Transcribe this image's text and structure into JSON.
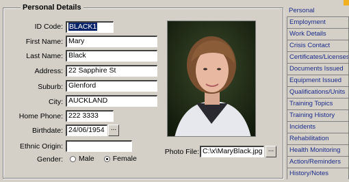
{
  "section_title": "Personal Details",
  "fields": {
    "id_code": {
      "label": "ID Code:",
      "value": "BLACK1"
    },
    "first_name": {
      "label": "First Name:",
      "value": "Mary"
    },
    "last_name": {
      "label": "Last Name:",
      "value": "Black"
    },
    "address": {
      "label": "Address:",
      "value": "22 Sapphire St"
    },
    "suburb": {
      "label": "Suburb:",
      "value": "Glenford"
    },
    "city": {
      "label": "City:",
      "value": "AUCKLAND"
    },
    "home_phone": {
      "label": "Home Phone:",
      "value": "222 3333"
    },
    "birthdate": {
      "label": "Birthdate:",
      "value": "24/06/1954"
    },
    "ethnic_origin": {
      "label": "Ethnic Origin:",
      "value": ""
    }
  },
  "gender": {
    "label": "Gender:",
    "options": [
      "Male",
      "Female"
    ],
    "selected": "Female"
  },
  "photo_file": {
    "label": "Photo File:",
    "value": "C:\\x\\MaryBlack.jpg"
  },
  "ellipsis": "...",
  "tabs": [
    "Personal",
    "Employment",
    "Work Details",
    "Crisis Contact",
    "Certificates/Licenses",
    "Documents Issued",
    "Equipment Issued",
    "Qualifications/Units",
    "Training Topics",
    "Training History",
    "Incidents",
    "Rehabilitation",
    "Health Monitoring",
    "Action/Reminders",
    "History/Notes"
  ],
  "active_tab": "Personal"
}
